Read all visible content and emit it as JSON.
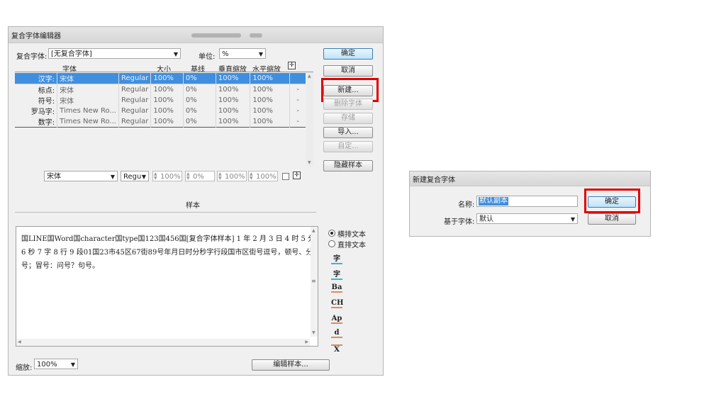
{
  "composite_editor": {
    "title": "复合字体编辑器",
    "composite_font_label": "复合字体:",
    "composite_font_value": "[无复合字体]",
    "unit_label": "单位:",
    "unit_value": "%",
    "columns": [
      "字体",
      "大小",
      "基线",
      "垂直缩放",
      "水平缩放"
    ],
    "rows": [
      {
        "name": "汉字:",
        "font": "宋体",
        "style": "Regular",
        "size": "100%",
        "baseline": "0%",
        "vscale": "100%",
        "hscale": "100%",
        "extra": ""
      },
      {
        "name": "标点:",
        "font": "宋体",
        "style": "Regular",
        "size": "100%",
        "baseline": "0%",
        "vscale": "100%",
        "hscale": "100%",
        "extra": "-"
      },
      {
        "name": "符号:",
        "font": "宋体",
        "style": "Regular",
        "size": "100%",
        "baseline": "0%",
        "vscale": "100%",
        "hscale": "100%",
        "extra": "-"
      },
      {
        "name": "罗马字:",
        "font": "Times New Ro...",
        "style": "Regular",
        "size": "100%",
        "baseline": "0%",
        "vscale": "100%",
        "hscale": "100%",
        "extra": "-"
      },
      {
        "name": "数字:",
        "font": "Times New Ro...",
        "style": "Regular",
        "size": "100%",
        "baseline": "0%",
        "vscale": "100%",
        "hscale": "100%",
        "extra": "-"
      }
    ],
    "buttons": {
      "ok": "确定",
      "cancel": "取消",
      "new": "新建...",
      "delete": "删除字体",
      "save": "存储",
      "import": "导入...",
      "custom": "自定...",
      "hide_sample": "隐藏样本",
      "edit_sample": "编辑样本..."
    },
    "edit_row": {
      "font": "宋体",
      "style": "Regu",
      "size": "100%",
      "baseline": "0%",
      "vscale": "100%",
      "hscale": "100%"
    },
    "sample_label": "样本",
    "sample_text": "国LINE国Word国character国type国123国456国[复合字体样本] 1 年 2 月 3 日 4 时 5 分 6 秒 7 字 8 行 9 段01国23市45区67街89号年月日时分秒字行段国市区街号逗号，顿号、分号；冒号：问号？句号。",
    "orientation": {
      "horizontal": "横排文本",
      "vertical": "直排文本"
    },
    "tools": [
      "字",
      "字",
      "Ba",
      "CH",
      "Ap",
      "d",
      "X"
    ],
    "zoom_label": "缩放:",
    "zoom_value": "100%"
  },
  "new_composite": {
    "title": "新建复合字体",
    "name_label": "名称:",
    "name_value": "默认副本",
    "base_label": "基于字体:",
    "base_value": "默认",
    "ok": "确定",
    "cancel": "取消"
  }
}
